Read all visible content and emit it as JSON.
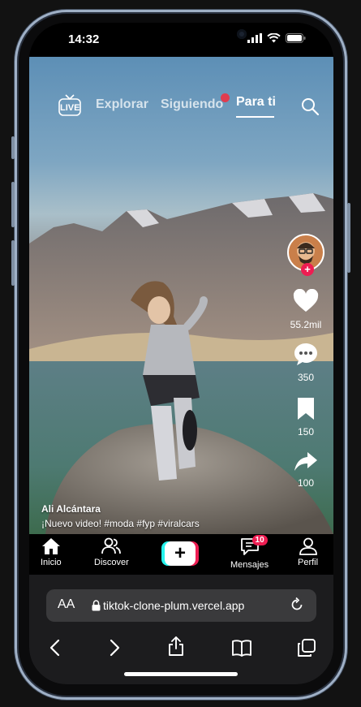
{
  "status_bar": {
    "time": "14:32"
  },
  "top_nav": {
    "live_label": "LIVE",
    "tabs": [
      {
        "label": "Explorar"
      },
      {
        "label": "Siguiendo"
      },
      {
        "label": "Para ti"
      }
    ]
  },
  "rail": {
    "likes": "55.2mil",
    "comments": "350",
    "saves": "150",
    "shares": "100"
  },
  "caption": {
    "author": "Ali Alcántara",
    "text": "¡Nuevo video! #moda #fyp #viralcars"
  },
  "app_nav": {
    "items": [
      {
        "label": "Inicio"
      },
      {
        "label": "Discover"
      },
      {
        "label": "Mensajes",
        "badge": "10"
      },
      {
        "label": "Perfil"
      }
    ],
    "plus": "+"
  },
  "safari": {
    "aa": "AA",
    "url": "tiktok-clone-plum.vercel.app"
  },
  "colors": {
    "accent_red": "#ee1d52",
    "accent_cyan": "#25f4ee",
    "frame": "#9fb0c6"
  }
}
